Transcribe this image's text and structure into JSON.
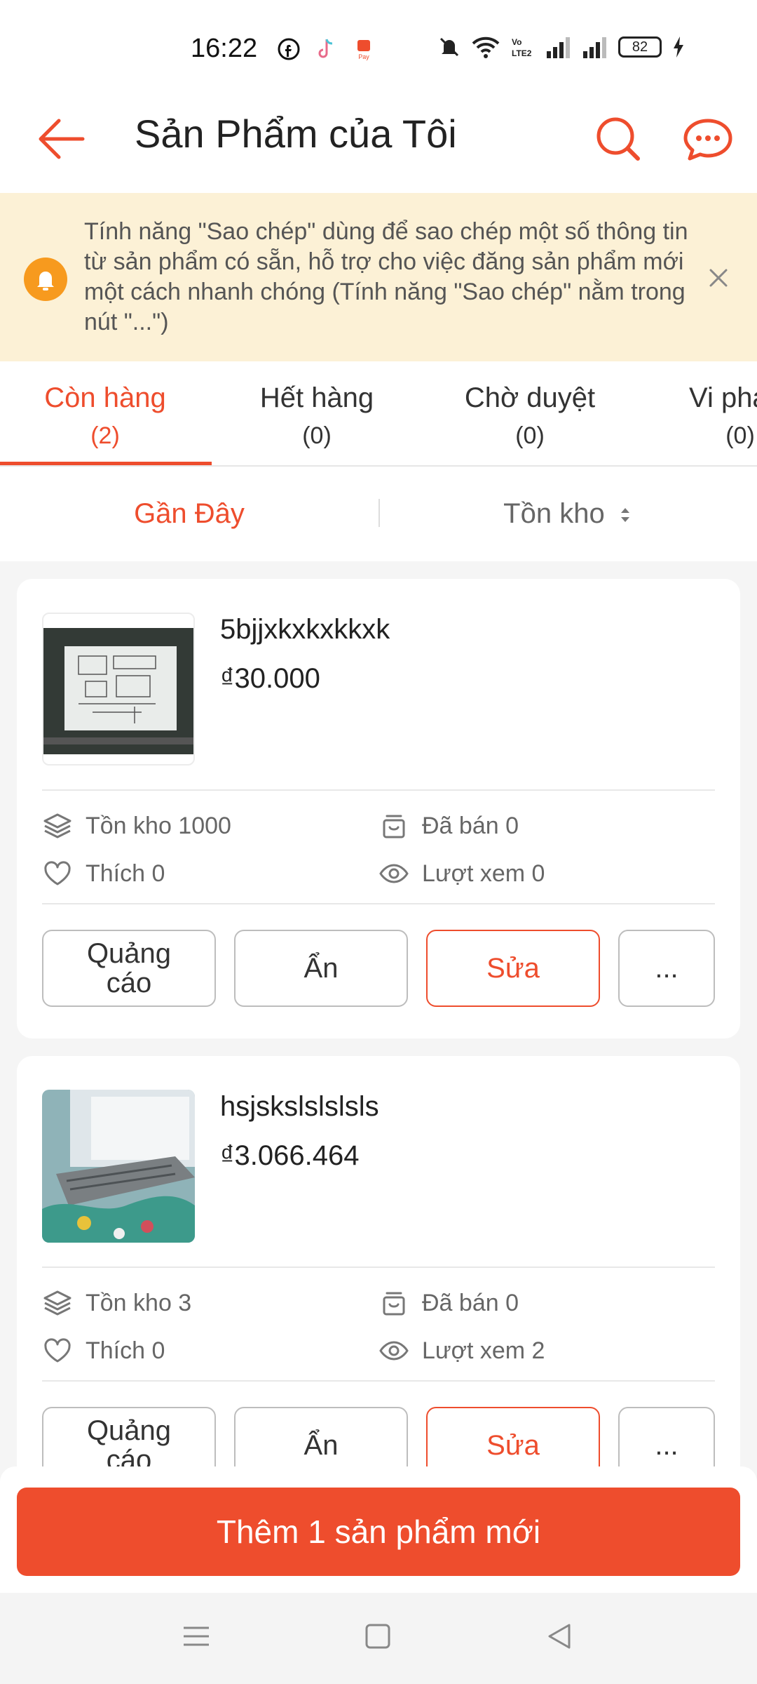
{
  "status_bar": {
    "time": "16:22",
    "battery": "82"
  },
  "header": {
    "title": "Sản Phẩm của Tôi"
  },
  "notice": {
    "text": "Tính năng \"Sao chép\" dùng để sao chép một số thông tin từ sản phẩm có sẵn, hỗ trợ cho việc đăng sản phẩm mới một cách nhanh chóng (Tính năng \"Sao chép\" nằm trong nút \"...\")"
  },
  "tabs": [
    {
      "label": "Còn hàng",
      "count": "(2)"
    },
    {
      "label": "Hết hàng",
      "count": "(0)"
    },
    {
      "label": "Chờ duyệt",
      "count": "(0)"
    },
    {
      "label": "Vi phạm",
      "count": "(0)"
    }
  ],
  "sort": {
    "recent": "Gần Đây",
    "stock": "Tồn kho"
  },
  "products": [
    {
      "name": "5bjjxkxkxkkxk",
      "price": "₫30.000",
      "stock": "Tồn kho 1000",
      "sold": "Đã bán 0",
      "likes": "Thích 0",
      "views": "Lượt xem 0"
    },
    {
      "name": "hsjskslslslsls",
      "price": "₫3.066.464",
      "stock": "Tồn kho 3",
      "sold": "Đã bán 0",
      "likes": "Thích 0",
      "views": "Lượt xem 2"
    }
  ],
  "actions": {
    "ads": "Quảng cáo",
    "hide": "Ẩn",
    "edit": "Sửa",
    "more": "..."
  },
  "add_button": "Thêm 1 sản phẩm mới",
  "colors": {
    "accent": "#ee4d2d",
    "notice_bg": "#fcf1d6",
    "notice_icon": "#f79a1e"
  }
}
